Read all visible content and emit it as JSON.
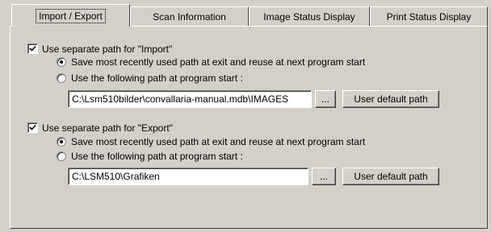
{
  "tabs": [
    {
      "label": "Import / Export",
      "active": true
    },
    {
      "label": "Scan Information",
      "active": false
    },
    {
      "label": "Image Status Display",
      "active": false
    },
    {
      "label": "Print Status Display",
      "active": false
    }
  ],
  "import": {
    "checkbox_label": "Use separate path for \"Import\"",
    "checked": true,
    "option_recent": "Save most recently used path at exit and reuse at next program start",
    "option_following": "Use the following path at program start :",
    "selected_option": "recent",
    "path_value": "C:\\Lsm510bilder\\convallaria-manual.mdb\\IMAGES",
    "browse_label": "...",
    "default_label": "User default path"
  },
  "export": {
    "checkbox_label": "Use separate path for \"Export\"",
    "checked": true,
    "option_recent": "Save most recently used path at exit and reuse at next program start",
    "option_following": "Use the following path at program start :",
    "selected_option": "recent",
    "path_value": "C:\\LSM510\\Grafiken",
    "browse_label": "...",
    "default_label": "User default path"
  }
}
